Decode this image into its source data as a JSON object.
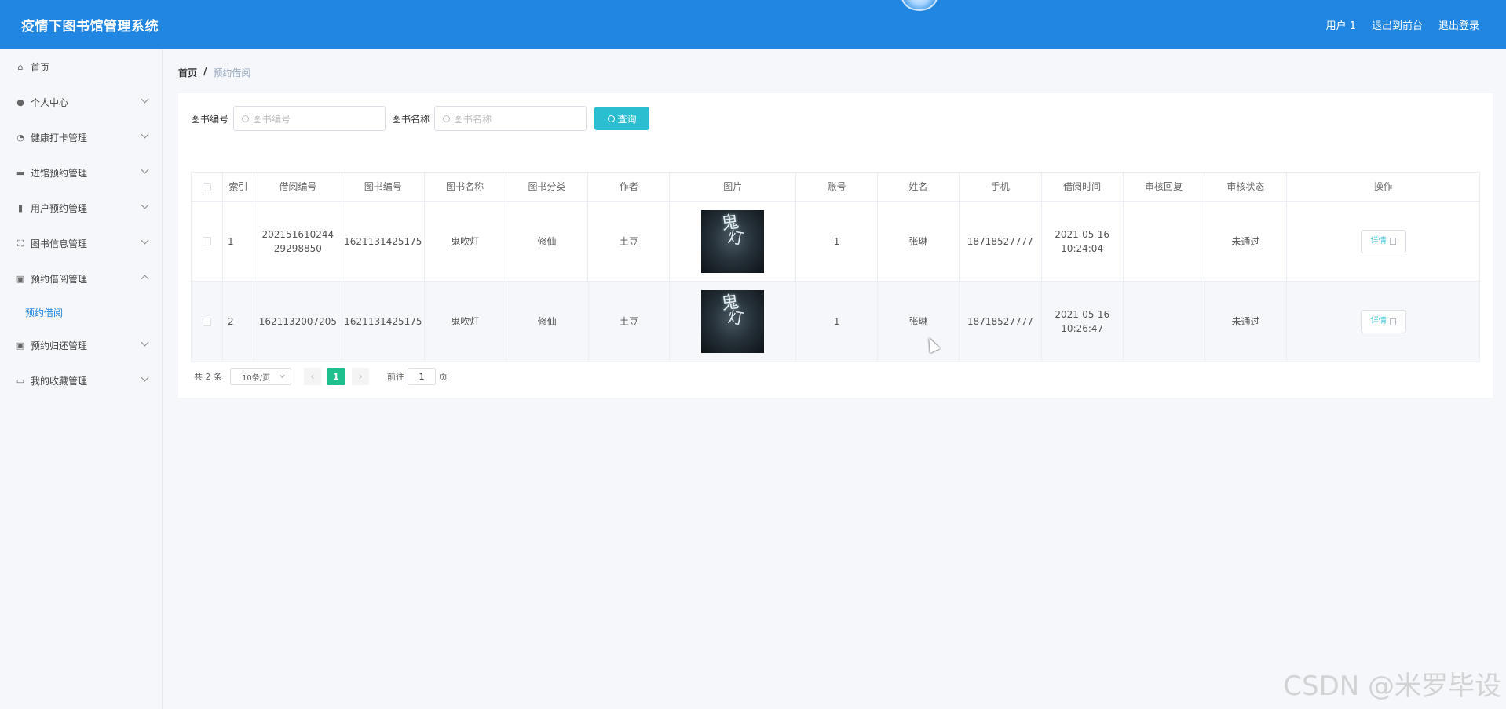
{
  "header": {
    "title": "疫情下图书馆管理系统",
    "user_label": "用户 1",
    "front_label": "退出到前台",
    "logout_label": "退出登录",
    "bg_color": "#2086e2"
  },
  "sidebar": {
    "items": [
      {
        "label": "首页",
        "icon": "home-icon",
        "expandable": false
      },
      {
        "label": "个人中心",
        "icon": "user-icon",
        "expandable": true
      },
      {
        "label": "健康打卡管理",
        "icon": "dashboard-icon",
        "expandable": true
      },
      {
        "label": "进馆预约管理",
        "icon": "briefcase-icon",
        "expandable": true
      },
      {
        "label": "用户预约管理",
        "icon": "bar-chart-icon",
        "expandable": true
      },
      {
        "label": "图书信息管理",
        "icon": "fullscreen-icon",
        "expandable": true
      },
      {
        "label": "预约借阅管理",
        "icon": "clipboard-icon",
        "expandable": true,
        "open": true
      },
      {
        "label": "预约归还管理",
        "icon": "clipboard-icon",
        "expandable": true
      },
      {
        "label": "我的收藏管理",
        "icon": "monitor-icon",
        "expandable": true
      }
    ],
    "submenu_label": "预约借阅"
  },
  "breadcrumb": {
    "home": "首页",
    "separator": "/",
    "current": "预约借阅"
  },
  "search": {
    "book_no_label": "图书编号",
    "book_no_placeholder": "图书编号",
    "book_name_label": "图书名称",
    "book_name_placeholder": "图书名称",
    "query_label": "查询",
    "accent": "#2bbed1"
  },
  "table": {
    "headers": [
      "索引",
      "借阅编号",
      "图书编号",
      "图书名称",
      "图书分类",
      "作者",
      "图片",
      "账号",
      "姓名",
      "手机",
      "借阅时间",
      "审核回复",
      "审核状态",
      "操作"
    ],
    "rows": [
      {
        "index": "1",
        "borrow_no": "20215161024429298850",
        "book_no": "1621131425175",
        "book_name": "鬼吹灯",
        "category": "修仙",
        "author": "土豆",
        "account": "1",
        "name": "张琳",
        "phone": "18718527777",
        "time": "2021-05-16 10:24:04",
        "reply": "",
        "status": "未通过",
        "action": "详情"
      },
      {
        "index": "2",
        "borrow_no": "1621132007205",
        "book_no": "1621131425175",
        "book_name": "鬼吹灯",
        "category": "修仙",
        "author": "土豆",
        "account": "1",
        "name": "张琳",
        "phone": "18718527777",
        "time": "2021-05-16 10:26:47",
        "reply": "",
        "status": "未通过",
        "action": "详情"
      }
    ]
  },
  "pager": {
    "total": "共 2 条",
    "page_size": "10条/页",
    "current_page": "1",
    "goto_label": "前往",
    "goto_value": "1",
    "page_suffix": "页",
    "active_color": "#1ec08d"
  },
  "watermark": "CSDN @米罗毕设"
}
